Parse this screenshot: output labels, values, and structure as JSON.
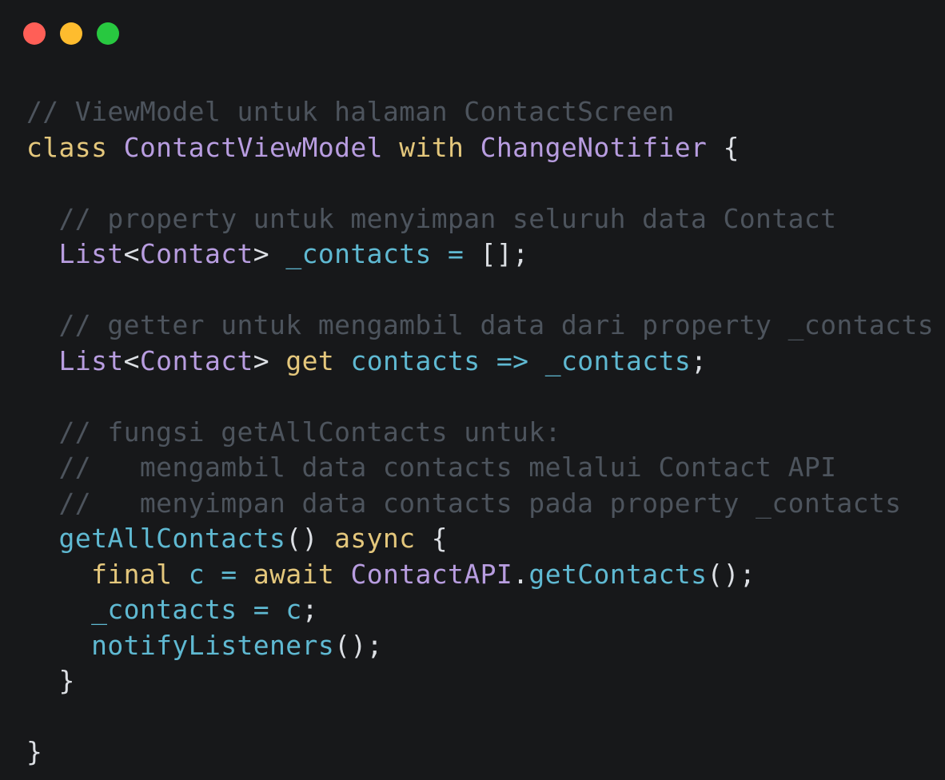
{
  "window": {
    "controls": [
      {
        "name": "close",
        "color": "#ff5f57"
      },
      {
        "name": "minimize",
        "color": "#febc2e"
      },
      {
        "name": "zoom",
        "color": "#28c840"
      }
    ]
  },
  "colors": {
    "background": "#17181a",
    "comment": "#4d545d",
    "keyword": "#e4c77c",
    "type": "#b89de0",
    "identifier": "#5fb9d2",
    "punctuation": "#dcdfe4"
  },
  "code_lines": [
    [
      {
        "t": "comment",
        "v": "// ViewModel untuk halaman ContactScreen"
      }
    ],
    [
      {
        "t": "keyword",
        "v": "class"
      },
      {
        "t": "plain",
        "v": " "
      },
      {
        "t": "type",
        "v": "ContactViewModel"
      },
      {
        "t": "plain",
        "v": " "
      },
      {
        "t": "keyword",
        "v": "with"
      },
      {
        "t": "plain",
        "v": " "
      },
      {
        "t": "type",
        "v": "ChangeNotifier"
      },
      {
        "t": "plain",
        "v": " "
      },
      {
        "t": "punct",
        "v": "{"
      }
    ],
    [],
    [
      {
        "t": "comment",
        "v": "  // property untuk menyimpan seluruh data Contact"
      }
    ],
    [
      {
        "t": "plain",
        "v": "  "
      },
      {
        "t": "type",
        "v": "List"
      },
      {
        "t": "punct",
        "v": "<"
      },
      {
        "t": "type",
        "v": "Contact"
      },
      {
        "t": "punct",
        "v": ">"
      },
      {
        "t": "plain",
        "v": " "
      },
      {
        "t": "ident",
        "v": "_contacts"
      },
      {
        "t": "plain",
        "v": " "
      },
      {
        "t": "op",
        "v": "="
      },
      {
        "t": "plain",
        "v": " "
      },
      {
        "t": "punct",
        "v": "[];"
      }
    ],
    [],
    [
      {
        "t": "comment",
        "v": "  // getter untuk mengambil data dari property _contacts"
      }
    ],
    [
      {
        "t": "plain",
        "v": "  "
      },
      {
        "t": "type",
        "v": "List"
      },
      {
        "t": "punct",
        "v": "<"
      },
      {
        "t": "type",
        "v": "Contact"
      },
      {
        "t": "punct",
        "v": ">"
      },
      {
        "t": "plain",
        "v": " "
      },
      {
        "t": "keyword",
        "v": "get"
      },
      {
        "t": "plain",
        "v": " "
      },
      {
        "t": "ident",
        "v": "contacts"
      },
      {
        "t": "plain",
        "v": " "
      },
      {
        "t": "op",
        "v": "=>"
      },
      {
        "t": "plain",
        "v": " "
      },
      {
        "t": "ident",
        "v": "_contacts"
      },
      {
        "t": "punct",
        "v": ";"
      }
    ],
    [],
    [
      {
        "t": "comment",
        "v": "  // fungsi getAllContacts untuk:"
      }
    ],
    [
      {
        "t": "comment",
        "v": "  //   mengambil data contacts melalui Contact API"
      }
    ],
    [
      {
        "t": "comment",
        "v": "  //   menyimpan data contacts pada property _contacts"
      }
    ],
    [
      {
        "t": "plain",
        "v": "  "
      },
      {
        "t": "ident",
        "v": "getAllContacts"
      },
      {
        "t": "punct",
        "v": "()"
      },
      {
        "t": "plain",
        "v": " "
      },
      {
        "t": "keyword",
        "v": "async"
      },
      {
        "t": "plain",
        "v": " "
      },
      {
        "t": "punct",
        "v": "{"
      }
    ],
    [
      {
        "t": "plain",
        "v": "    "
      },
      {
        "t": "keyword",
        "v": "final"
      },
      {
        "t": "plain",
        "v": " "
      },
      {
        "t": "ident",
        "v": "c"
      },
      {
        "t": "plain",
        "v": " "
      },
      {
        "t": "op",
        "v": "="
      },
      {
        "t": "plain",
        "v": " "
      },
      {
        "t": "keyword",
        "v": "await"
      },
      {
        "t": "plain",
        "v": " "
      },
      {
        "t": "type",
        "v": "ContactAPI"
      },
      {
        "t": "punct",
        "v": "."
      },
      {
        "t": "ident",
        "v": "getContacts"
      },
      {
        "t": "punct",
        "v": "();"
      }
    ],
    [
      {
        "t": "plain",
        "v": "    "
      },
      {
        "t": "ident",
        "v": "_contacts"
      },
      {
        "t": "plain",
        "v": " "
      },
      {
        "t": "op",
        "v": "="
      },
      {
        "t": "plain",
        "v": " "
      },
      {
        "t": "ident",
        "v": "c"
      },
      {
        "t": "punct",
        "v": ";"
      }
    ],
    [
      {
        "t": "plain",
        "v": "    "
      },
      {
        "t": "ident",
        "v": "notifyListeners"
      },
      {
        "t": "punct",
        "v": "();"
      }
    ],
    [
      {
        "t": "plain",
        "v": "  "
      },
      {
        "t": "punct",
        "v": "}"
      }
    ],
    [],
    [
      {
        "t": "punct",
        "v": "}"
      }
    ]
  ]
}
